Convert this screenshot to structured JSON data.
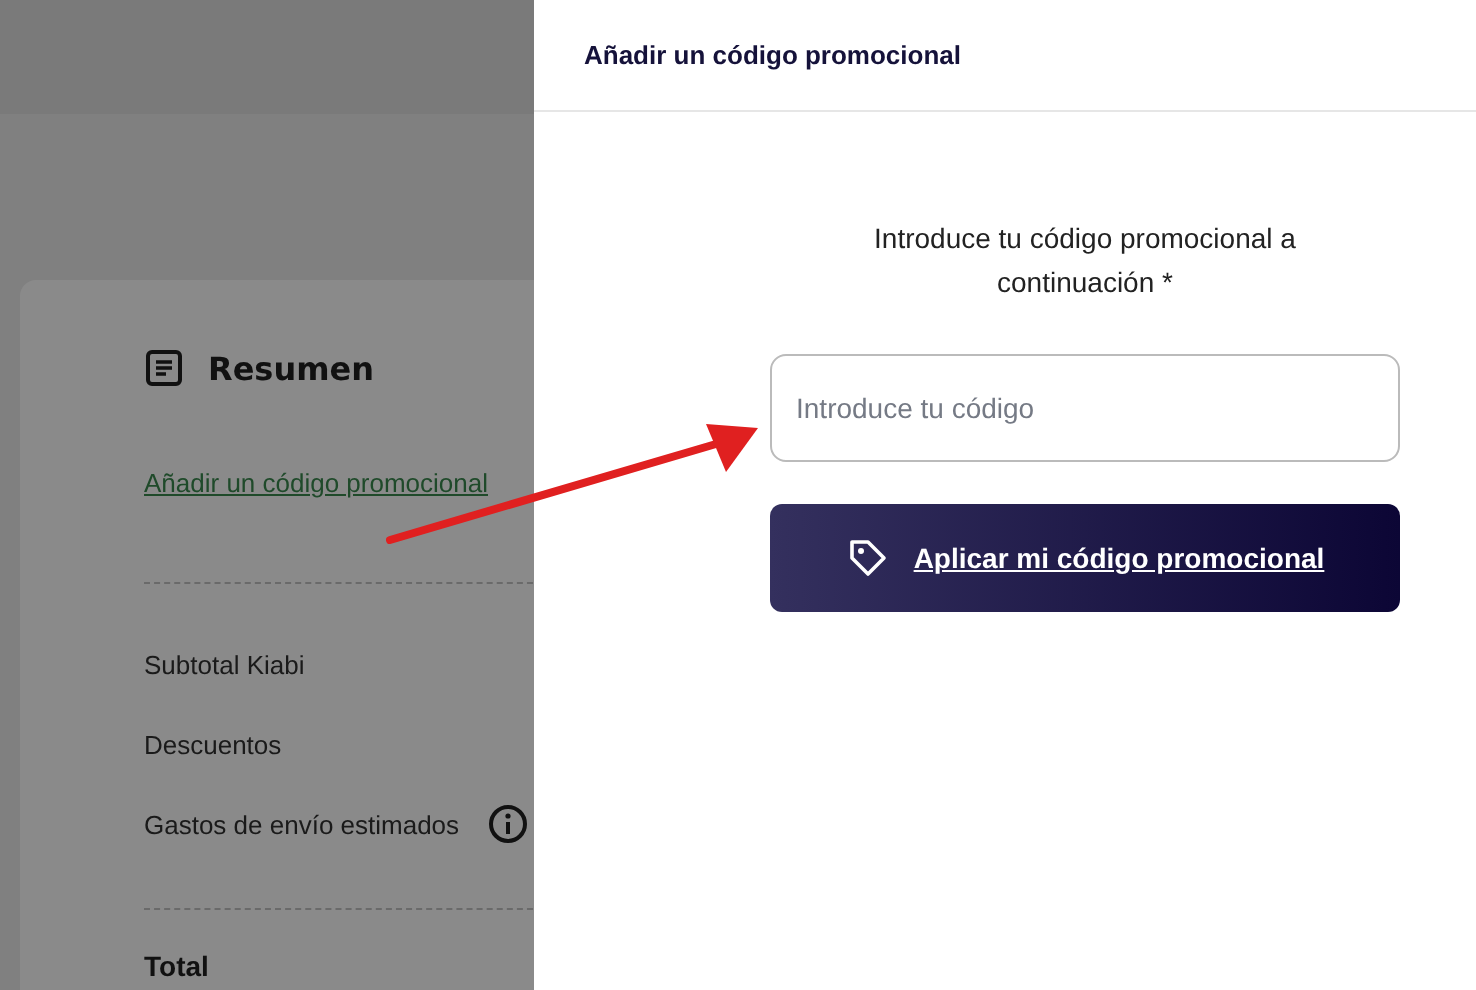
{
  "summary": {
    "title": "Resumen",
    "promo_link": "Añadir un código promocional",
    "rows": [
      {
        "label": "Subtotal Kiabi",
        "info": false
      },
      {
        "label": "Descuentos",
        "info": false
      },
      {
        "label": "Gastos de envío estimados",
        "info": true
      }
    ],
    "total_label": "Total"
  },
  "panel": {
    "title": "Añadir un código promocional",
    "instruction": "Introduce tu código promocional a continuación *",
    "code_field": {
      "placeholder": "Introduce tu código"
    },
    "apply_button": "Aplicar mi código promocional"
  }
}
